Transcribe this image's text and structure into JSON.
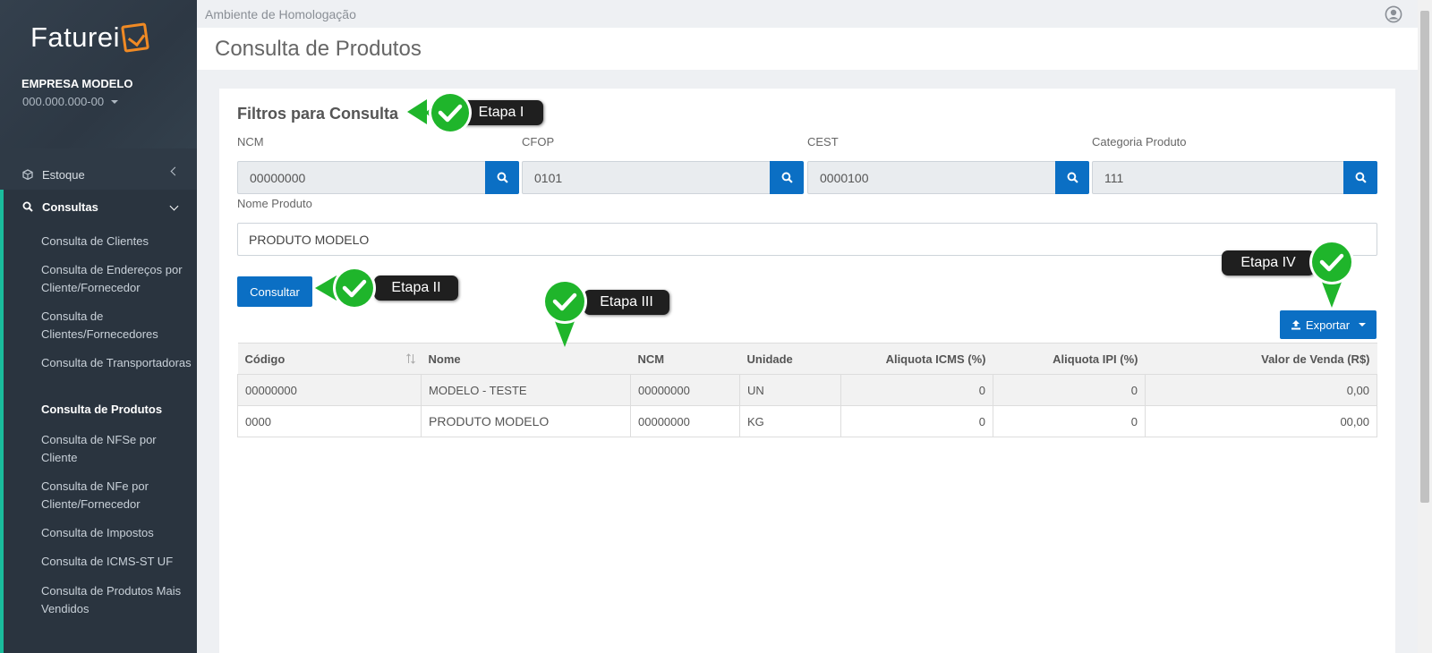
{
  "sidebar": {
    "logo_text": "Faturei",
    "company_name": "EMPRESA MODELO",
    "company_code": "000.000.000-00",
    "estoque_label": "Estoque",
    "consultas_label": "Consultas",
    "items": [
      {
        "label": "Consulta de Clientes"
      },
      {
        "label": "Consulta de Endereços por Cliente/Fornecedor"
      },
      {
        "label": "Consulta de Clientes/Fornecedores"
      },
      {
        "label": "Consulta de Transportadoras"
      },
      {
        "label": "Consulta de Produtos"
      },
      {
        "label": "Consulta de NFSe por Cliente"
      },
      {
        "label": "Consulta de NFe por Cliente/Fornecedor"
      },
      {
        "label": "Consulta de Impostos"
      },
      {
        "label": "Consulta de ICMS-ST UF"
      },
      {
        "label": "Consulta de Produtos Mais Vendidos"
      }
    ]
  },
  "header": {
    "environment": "Ambiente de Homologação",
    "page_title": "Consulta de Produtos"
  },
  "filters": {
    "title": "Filtros para Consulta",
    "ncm_label": "NCM",
    "ncm_value": "00000000",
    "cfop_label": "CFOP",
    "cfop_value": "0101",
    "cest_label": "CEST",
    "cest_value": "0000100",
    "categoria_label": "Categoria Produto",
    "categoria_value": "111",
    "nome_label": "Nome Produto",
    "nome_value": "PRODUTO MODELO",
    "consultar_button": "Consultar",
    "exportar_button": "Exportar"
  },
  "table": {
    "headers": [
      "Código",
      "Nome",
      "NCM",
      "Unidade",
      "Aliquota ICMS (%)",
      "Aliquota IPI (%)",
      "Valor de Venda (R$)"
    ],
    "rows": [
      [
        "00000000",
        "MODELO - TESTE",
        "00000000",
        "UN",
        "0",
        "0",
        "0,00"
      ],
      [
        "0000",
        "PRODUTO MODELO",
        "00000000",
        "KG",
        "0",
        "0",
        "00,00"
      ]
    ]
  },
  "steps": {
    "step1": "Etapa I",
    "step2": "Etapa II",
    "step3": "Etapa III",
    "step4": "Etapa IV"
  },
  "colors": {
    "sidebar_bg": "#2f3a46",
    "accent_green": "#1abc9c",
    "primary_blue": "#0b6fc4",
    "step_green": "#1fb52b"
  }
}
